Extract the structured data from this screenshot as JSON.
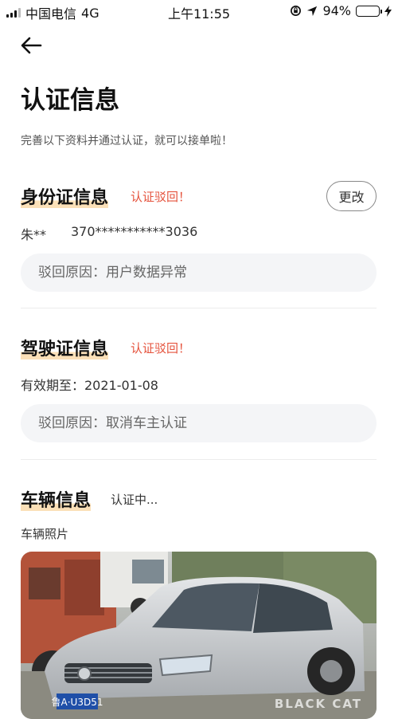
{
  "status_bar": {
    "carrier": "中国电信",
    "network": "4G",
    "time": "上午11:55",
    "battery": "94%",
    "battery_level": 0.94
  },
  "header": {
    "title": "认证信息",
    "subtitle": "完善以下资料并通过认证，就可以接单啦！"
  },
  "id_section": {
    "title": "身份证信息",
    "status": "认证驳回！",
    "edit_label": "更改",
    "name": "朱**",
    "id_number": "370***********3036",
    "reject_reason": "驳回原因：用户数据异常"
  },
  "license_section": {
    "title": "驾驶证信息",
    "status": "认证驳回！",
    "validity": "有效期至：2021-01-08",
    "reject_reason": "驳回原因：取消车主认证"
  },
  "vehicle_section": {
    "title": "车辆信息",
    "status": "认证中...",
    "photo_label": "车辆照片",
    "plate": "鲁A·U3D51",
    "watermark": "BLACK CAT"
  }
}
